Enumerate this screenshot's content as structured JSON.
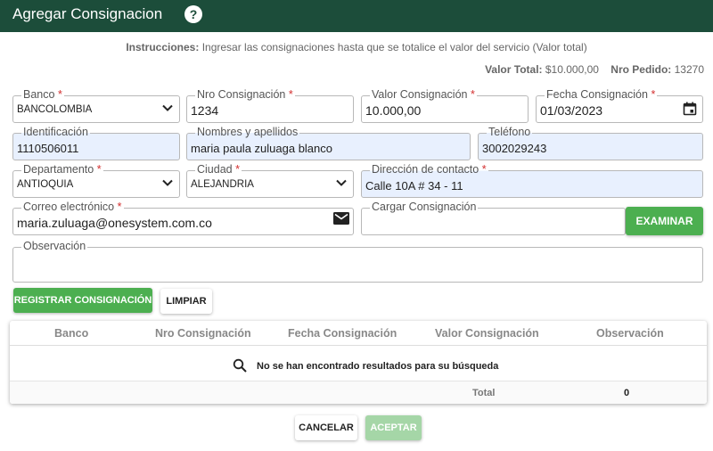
{
  "header": {
    "title": "Agregar Consignacion",
    "help_glyph": "?"
  },
  "instructions": {
    "label": "Instrucciones:",
    "text": "Ingresar las consignaciones hasta que se totalice el valor del servicio (Valor total)"
  },
  "totals": {
    "valor_total_label": "Valor Total:",
    "valor_total": "$10.000,00",
    "nro_pedido_label": "Nro Pedido:",
    "nro_pedido": "13270"
  },
  "form": {
    "banco": {
      "label": "Banco",
      "value": "BANCOLOMBIA"
    },
    "nro_consignacion": {
      "label": "Nro Consignación",
      "value": "1234"
    },
    "valor_consignacion": {
      "label": "Valor Consignación",
      "value": "10.000,00"
    },
    "fecha_consignacion": {
      "label": "Fecha Consignación",
      "value": "01/03/2023"
    },
    "identificacion": {
      "label": "Identificación",
      "value": "1110506011"
    },
    "nombres": {
      "label": "Nombres y apellidos",
      "value": "maria paula zuluaga blanco"
    },
    "telefono": {
      "label": "Teléfono",
      "value": "3002029243"
    },
    "departamento": {
      "label": "Departamento",
      "value": "ANTIOQUIA"
    },
    "ciudad": {
      "label": "Ciudad",
      "value": "ALEJANDRIA"
    },
    "direccion": {
      "label": "Dirección de contacto",
      "value": "Calle 10A # 34 - 11"
    },
    "correo": {
      "label": "Correo electrónico",
      "value": "maria.zuluaga@onesystem.com.co"
    },
    "cargar": {
      "label": "Cargar Consignación",
      "value": ""
    },
    "observacion": {
      "label": "Observación",
      "value": ""
    },
    "required_mark": "*"
  },
  "buttons": {
    "examinar": "EXAMINAR",
    "registrar": "REGISTRAR CONSIGNACIÓN",
    "limpiar": "LIMPIAR",
    "cancelar": "CANCELAR",
    "aceptar": "ACEPTAR"
  },
  "table": {
    "columns": [
      "Banco",
      "Nro Consignación",
      "Fecha Consignación",
      "Valor Consignación",
      "Observación"
    ],
    "empty_message": "No se han encontrado resultados para su búsqueda",
    "total_label": "Total",
    "total_value": "0"
  },
  "colors": {
    "header_bg": "#1c4d3a",
    "accent_green": "#4caf50",
    "required": "#d32f2f",
    "autofill_bg": "#e8f0fe"
  }
}
